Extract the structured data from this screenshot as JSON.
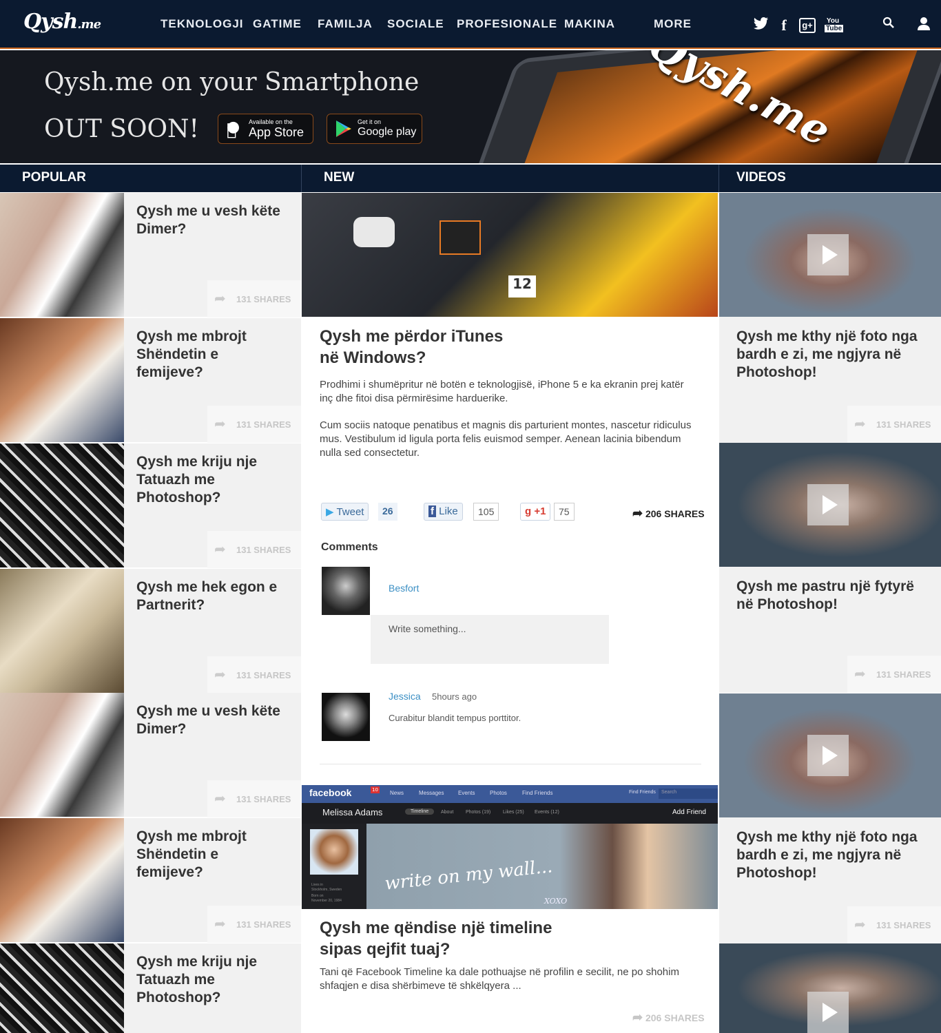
{
  "nav": {
    "logo": "Qysh",
    "logo_suffix": ".me",
    "items": [
      "TEKNOLOGJI",
      "GATIME",
      "FAMILJA",
      "SOCIALE",
      "PROFESIONALE",
      "MAKINA"
    ],
    "more": "MORE",
    "icons": [
      "twitter-icon",
      "facebook-icon",
      "google-plus-icon",
      "youtube-icon",
      "search-icon",
      "user-icon"
    ],
    "accent": "#c8641c",
    "bg": "#0b1a30"
  },
  "banner": {
    "line1": "Qysh.me on your Smartphone",
    "line2": "OUT SOON!",
    "appstore_small": "Available on the",
    "appstore_big": "App Store",
    "gplay_small": "Get it on",
    "gplay_big": "Google play",
    "phone_logo": "Qysh.me"
  },
  "columns": {
    "popular": "POPULAR",
    "new": "NEW",
    "videos": "VIDEOS"
  },
  "popular": [
    {
      "title": "Qysh me u vesh këte Dimer?",
      "shares": "131 SHARES"
    },
    {
      "title": "Qysh me mbrojt Shëndetin e femijeve?",
      "shares": "131 SHARES"
    },
    {
      "title": "Qysh me kriju nje Tatuazh me Photoshop?",
      "shares": "131 SHARES"
    },
    {
      "title": "Qysh me hek egon e Partnerit?",
      "shares": "131 SHARES"
    },
    {
      "title": "Qysh me u vesh këte Dimer?",
      "shares": "131 SHARES"
    },
    {
      "title": "Qysh me mbrojt Shëndetin e femijeve?",
      "shares": "131 SHARES"
    },
    {
      "title": "Qysh me kriju nje Tatuazh me Photoshop?",
      "shares": ""
    }
  ],
  "article1": {
    "title_l1": "Qysh me përdor iTunes",
    "title_l2": "në Windows?",
    "p1": "Prodhimi i shumëpritur në botën e teknologjisë, iPhone 5 e ka ekranin prej katër inç dhe fitoi disa përmirësime harduerike.",
    "p2": "Cum sociis natoque penatibus et magnis dis parturient montes, nascetur ridiculus mus. Vestibulum id ligula porta felis euismod semper. Aenean lacinia bibendum nulla sed consectetur.",
    "tweet": "Tweet",
    "tweet_count": "26",
    "like": "Like",
    "like_count": "105",
    "plus": "+1",
    "plus_count": "75",
    "shares": "206 SHARES",
    "tile_number": "12"
  },
  "comments": {
    "heading": "Comments",
    "user": "Besfort",
    "placeholder": "Write something...",
    "c1_name": "Jessica",
    "c1_time": "5hours ago",
    "c1_text": "Curabitur blandit tempus porttitor."
  },
  "fb": {
    "brand": "facebook",
    "notif": "10",
    "tabs": [
      "News",
      "Messages",
      "Events",
      "Photos",
      "Find Friends"
    ],
    "find": "Find Friends",
    "search": "Search",
    "name": "Melissa Adams",
    "subtabs": [
      "Timeline",
      "About",
      "Photos (19)",
      "Likes (25)",
      "Events (12)"
    ],
    "add_friend": "Add Friend",
    "lives_in": "Lives in",
    "lives_in_place": "Stockholm, Sweden",
    "born_on": "Born on",
    "born_on_date": "November 20, 1984",
    "wall": "write on my wall...",
    "xoxo": "XOXO"
  },
  "article2": {
    "title_l1": "Qysh me qëndise një timeline",
    "title_l2": "sipas qejfit tuaj?",
    "body": "Tani që Facebook Timeline ka dale pothuajse në profilin e secilit, ne po shohim shfaqjen e disa shërbimeve të shkëlqyera ...",
    "shares": "206 SHARES"
  },
  "videos": [
    {
      "title": "Qysh me kthy një foto nga bardh e zi, me ngjyra në Photoshop!",
      "shares": "131 SHARES"
    },
    {
      "title": "Qysh me pastru një fytyrë në Photoshop!",
      "shares": "131 SHARES"
    },
    {
      "title": "Qysh me kthy një foto nga bardh e zi, me ngjyra në Photoshop!",
      "shares": "131 SHARES"
    },
    {
      "title": "",
      "shares": ""
    }
  ]
}
